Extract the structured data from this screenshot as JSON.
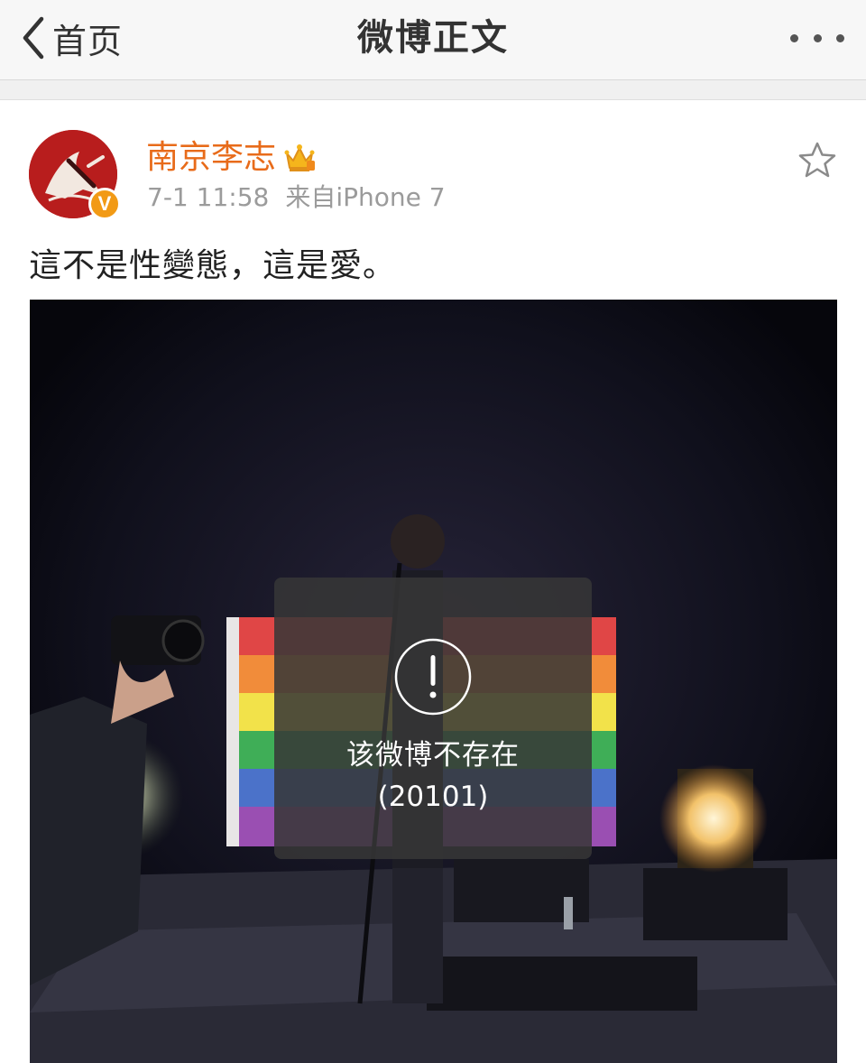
{
  "navbar": {
    "back_label": "首页",
    "title": "微博正文",
    "back_icon": "chevron-left-icon",
    "more_icon": "more-dots-icon"
  },
  "post": {
    "username": "南京李志",
    "time": "7-1 11:58",
    "source": "来自iPhone 7",
    "text": "這不是性變態，這是愛。",
    "avatar_icon": "avatar",
    "verified_badge": "V",
    "favorite_icon": "star-icon",
    "username_color": "#e86b1a"
  },
  "toast": {
    "icon": "exclamation-circle-icon",
    "message": "该微博不存在",
    "code": "(20101)"
  },
  "colors": {
    "accent_orange": "#e86b1a",
    "meta_gray": "#9b9b9b",
    "badge_orange": "#f29a15",
    "avatar_red": "#b81d1d"
  }
}
